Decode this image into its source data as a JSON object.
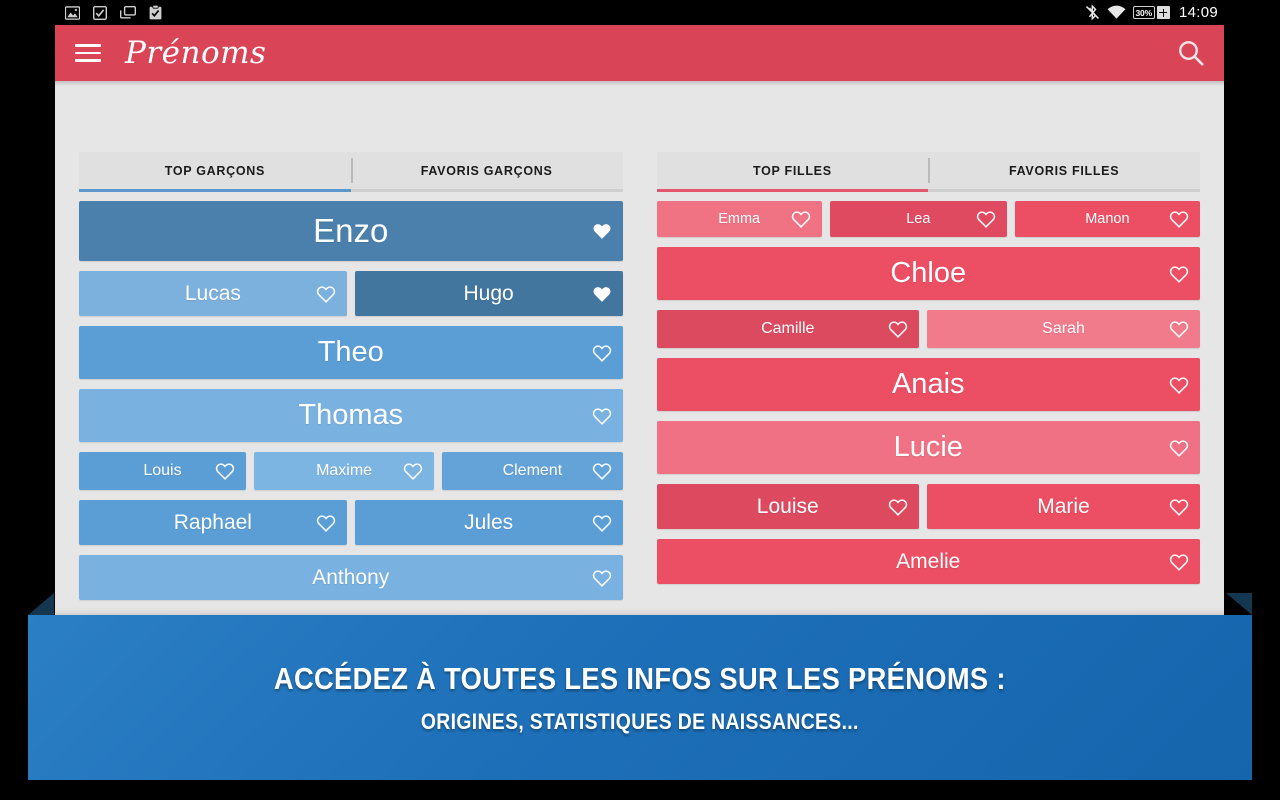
{
  "statusbar": {
    "icons": [
      "image-icon",
      "checkbox-icon",
      "copy-icon",
      "clipboard-check-icon"
    ],
    "right_icons": [
      "bluetooth-off-icon",
      "wifi-icon"
    ],
    "battery_text": "30%",
    "time": "14:09"
  },
  "appbar": {
    "menu_icon": "hamburger-menu-icon",
    "title": "Prénoms",
    "search_icon": "search-icon",
    "background": "#d94557"
  },
  "columns": [
    {
      "id": "boys",
      "accent": "#5a97cd",
      "tabs": [
        {
          "label": "TOP GARÇONS",
          "active": true
        },
        {
          "label": "FAVORIS GARÇONS",
          "active": false
        }
      ],
      "rows": [
        [
          {
            "name": "Enzo",
            "size": "xl",
            "color": "#4a80ab",
            "flex": 1,
            "fav": true
          }
        ],
        [
          {
            "name": "Lucas",
            "size": "m",
            "color": "#7cb0dd",
            "flex": 1,
            "fav": false
          },
          {
            "name": "Hugo",
            "size": "m",
            "color": "#42769f",
            "flex": 1,
            "fav": true
          }
        ],
        [
          {
            "name": "Theo",
            "size": "l",
            "color": "#5b9ed6",
            "flex": 1,
            "fav": false
          }
        ],
        [
          {
            "name": "Thomas",
            "size": "l",
            "color": "#79b1e0",
            "flex": 1,
            "fav": false
          }
        ],
        [
          {
            "name": "Louis",
            "size": "s",
            "color": "#5b9ed6",
            "flex": 1,
            "fav": false
          },
          {
            "name": "Maxime",
            "size": "s",
            "color": "#7cb4e2",
            "flex": 1.08,
            "fav": false
          },
          {
            "name": "Clement",
            "size": "s",
            "color": "#63a3d8",
            "flex": 1.08,
            "fav": false
          }
        ],
        [
          {
            "name": "Raphael",
            "size": "m",
            "color": "#5b9ed6",
            "flex": 1,
            "fav": false
          },
          {
            "name": "Jules",
            "size": "m",
            "color": "#5b9ed6",
            "flex": 1,
            "fav": false
          }
        ],
        [
          {
            "name": "Anthony",
            "size": "m",
            "color": "#79b1e0",
            "flex": 1,
            "fav": false
          }
        ]
      ]
    },
    {
      "id": "girls",
      "accent": "#e3566c",
      "tabs": [
        {
          "label": "TOP FILLES",
          "active": true
        },
        {
          "label": "FAVORIS FILLES",
          "active": false
        }
      ],
      "rows": [
        [
          {
            "name": "Emma",
            "size": "xs",
            "color": "#f07383",
            "flex": 1,
            "fav": false
          },
          {
            "name": "Lea",
            "size": "xs",
            "color": "#e04a60",
            "flex": 1.07,
            "fav": false
          },
          {
            "name": "Manon",
            "size": "xs",
            "color": "#ec4f63",
            "flex": 1.12,
            "fav": false
          }
        ],
        [
          {
            "name": "Chloe",
            "size": "l",
            "color": "#ec4f63",
            "flex": 1,
            "fav": false
          }
        ],
        [
          {
            "name": "Camille",
            "size": "s",
            "color": "#dc4a60",
            "flex": 1,
            "fav": false
          },
          {
            "name": "Sarah",
            "size": "s",
            "color": "#f27b8b",
            "flex": 1.04,
            "fav": false
          }
        ],
        [
          {
            "name": "Anais",
            "size": "l",
            "color": "#ec4f63",
            "flex": 1,
            "fav": false
          }
        ],
        [
          {
            "name": "Lucie",
            "size": "l",
            "color": "#ef7183",
            "flex": 1,
            "fav": false
          }
        ],
        [
          {
            "name": "Louise",
            "size": "m",
            "color": "#dd4a60",
            "flex": 1,
            "fav": false
          },
          {
            "name": "Marie",
            "size": "m",
            "color": "#ec4f63",
            "flex": 1.04,
            "fav": false
          }
        ],
        [
          {
            "name": "Amelie",
            "size": "m",
            "color": "#ec4f63",
            "flex": 1,
            "fav": false
          }
        ]
      ]
    }
  ],
  "banner": {
    "line1": "ACCÉDEZ À TOUTES LES INFOS SUR LES PRÉNOMS :",
    "line2": "ORIGINES, STATISTIQUES DE NAISSANCES..."
  }
}
